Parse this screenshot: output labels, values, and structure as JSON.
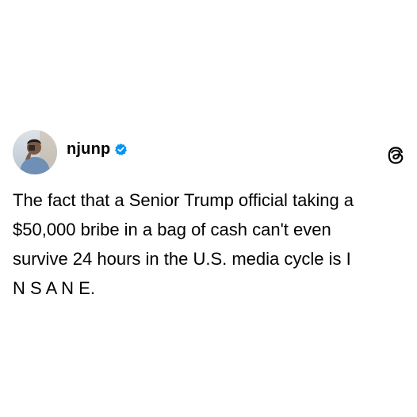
{
  "post": {
    "author": {
      "username": "njunp",
      "verified": true,
      "avatar": "profile-photo"
    },
    "platform_icon": "threads-icon",
    "text": "The fact that a Senior Trump official taking a\n$50,000 bribe in a bag of cash can't even\nsurvive 24 hours in the U.S. media cycle is I\nN S A N E."
  },
  "colors": {
    "background": "#ffffff",
    "text": "#000000",
    "verified_badge": "#0095f6"
  }
}
